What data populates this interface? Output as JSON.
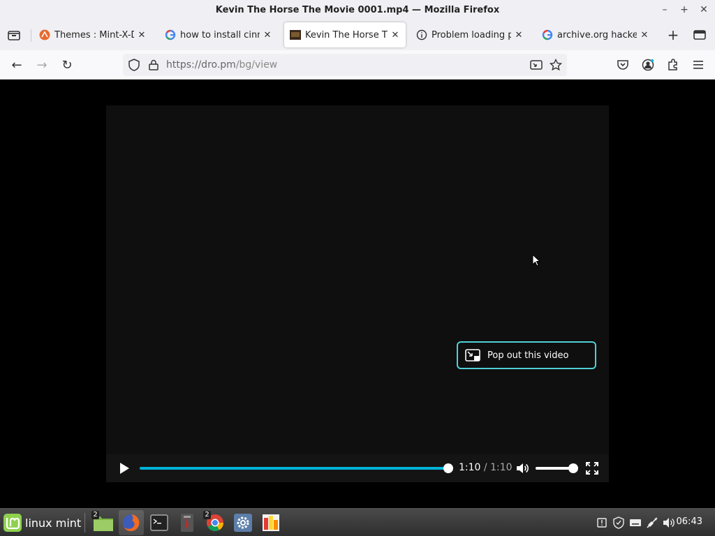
{
  "window": {
    "title": "Kevin The Horse The Movie 0001.mp4 — Mozilla Firefox",
    "minimize": "–",
    "maximize": "+",
    "close": "✕"
  },
  "tabs": [
    {
      "label": "Themes : Mint-X-Dar",
      "icon": "themes-site-icon",
      "active": false
    },
    {
      "label": "how to install cinnam",
      "icon": "google-icon",
      "active": false
    },
    {
      "label": "Kevin The Horse The",
      "icon": "video-thumbnail-icon",
      "active": true
    },
    {
      "label": "Problem loading pag",
      "icon": "info-icon",
      "active": false
    },
    {
      "label": "archive.org hacked -",
      "icon": "google-icon",
      "active": false
    }
  ],
  "tab_close_glyph": "✕",
  "new_tab_glyph": "+",
  "nav": {
    "back": "←",
    "forward": "→",
    "reload": "↻",
    "url_prefix": "https://dro.pm",
    "url_path": "/bg/view"
  },
  "video": {
    "current_time": "1:10",
    "separator": " / ",
    "total_time": "1:10",
    "progress": 1.0,
    "volume": 0.9,
    "pip_label": "Pop out this video",
    "accent": "#00b2d8",
    "pip_border": "#4fd0d8"
  },
  "taskbar": {
    "menu_label": "linux mint",
    "apps": [
      {
        "name": "files",
        "badge": "2",
        "active": false
      },
      {
        "name": "firefox",
        "badge": "",
        "active": true
      },
      {
        "name": "terminal",
        "badge": "",
        "active": false
      },
      {
        "name": "gimp",
        "badge": "",
        "active": false
      },
      {
        "name": "chrome",
        "badge": "2",
        "active": false
      },
      {
        "name": "settings",
        "badge": "",
        "active": false
      },
      {
        "name": "document-viewer",
        "badge": "",
        "active": false
      }
    ],
    "clock": "06:43"
  }
}
